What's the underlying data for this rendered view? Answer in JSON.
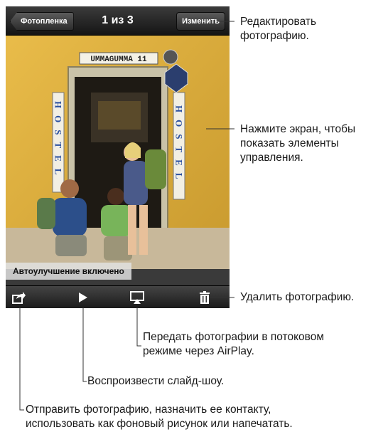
{
  "navbar": {
    "back_label": "Фотопленка",
    "title": "1 из 3",
    "edit_label": "Изменить"
  },
  "photo": {
    "sign_top": "UMMAGUMMA   11",
    "sign_left": "HOSTEL",
    "sign_right": "HOSTEL"
  },
  "banner": "Автоулучшение включено",
  "toolbar": {
    "icons": [
      "share-icon",
      "play-icon",
      "airplay-icon",
      "trash-icon"
    ]
  },
  "callouts": {
    "edit": [
      "Редактировать",
      "фотографию."
    ],
    "tap": [
      "Нажмите экран, чтобы",
      "показать элементы",
      "управления."
    ],
    "delete": "Удалить фотографию.",
    "airplay": [
      "Передать фотографии в потоковом",
      "режиме через AirPlay."
    ],
    "slideshow": "Воспроизвести слайд-шоу.",
    "share": [
      "Отправить фотографию, назначить ее контакту,",
      "использовать как фоновый рисунок или напечатать."
    ]
  }
}
